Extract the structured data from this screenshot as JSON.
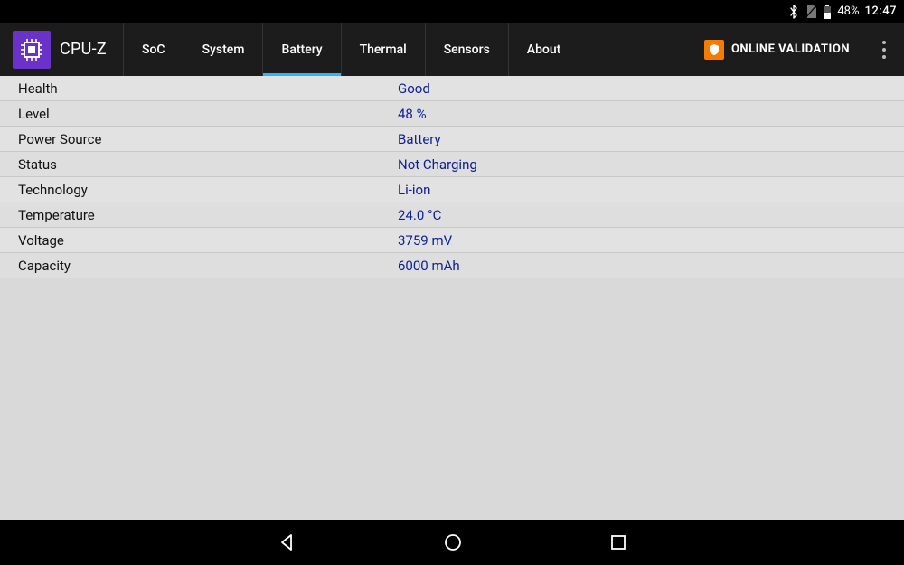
{
  "status": {
    "battery_pct": "48%",
    "clock": "12:47"
  },
  "app": {
    "title": "CPU-Z",
    "validation_label": "ONLINE VALIDATION"
  },
  "tabs": [
    {
      "id": "soc",
      "label": "SoC",
      "active": false
    },
    {
      "id": "system",
      "label": "System",
      "active": false
    },
    {
      "id": "battery",
      "label": "Battery",
      "active": true
    },
    {
      "id": "thermal",
      "label": "Thermal",
      "active": false
    },
    {
      "id": "sensors",
      "label": "Sensors",
      "active": false
    },
    {
      "id": "about",
      "label": "About",
      "active": false
    }
  ],
  "rows": [
    {
      "label": "Health",
      "value": "Good"
    },
    {
      "label": "Level",
      "value": "48 %"
    },
    {
      "label": "Power Source",
      "value": "Battery"
    },
    {
      "label": "Status",
      "value": "Not Charging"
    },
    {
      "label": "Technology",
      "value": "Li-ion"
    },
    {
      "label": "Temperature",
      "value": "24.0 °C"
    },
    {
      "label": "Voltage",
      "value": "3759 mV"
    },
    {
      "label": "Capacity",
      "value": "6000 mAh"
    }
  ]
}
